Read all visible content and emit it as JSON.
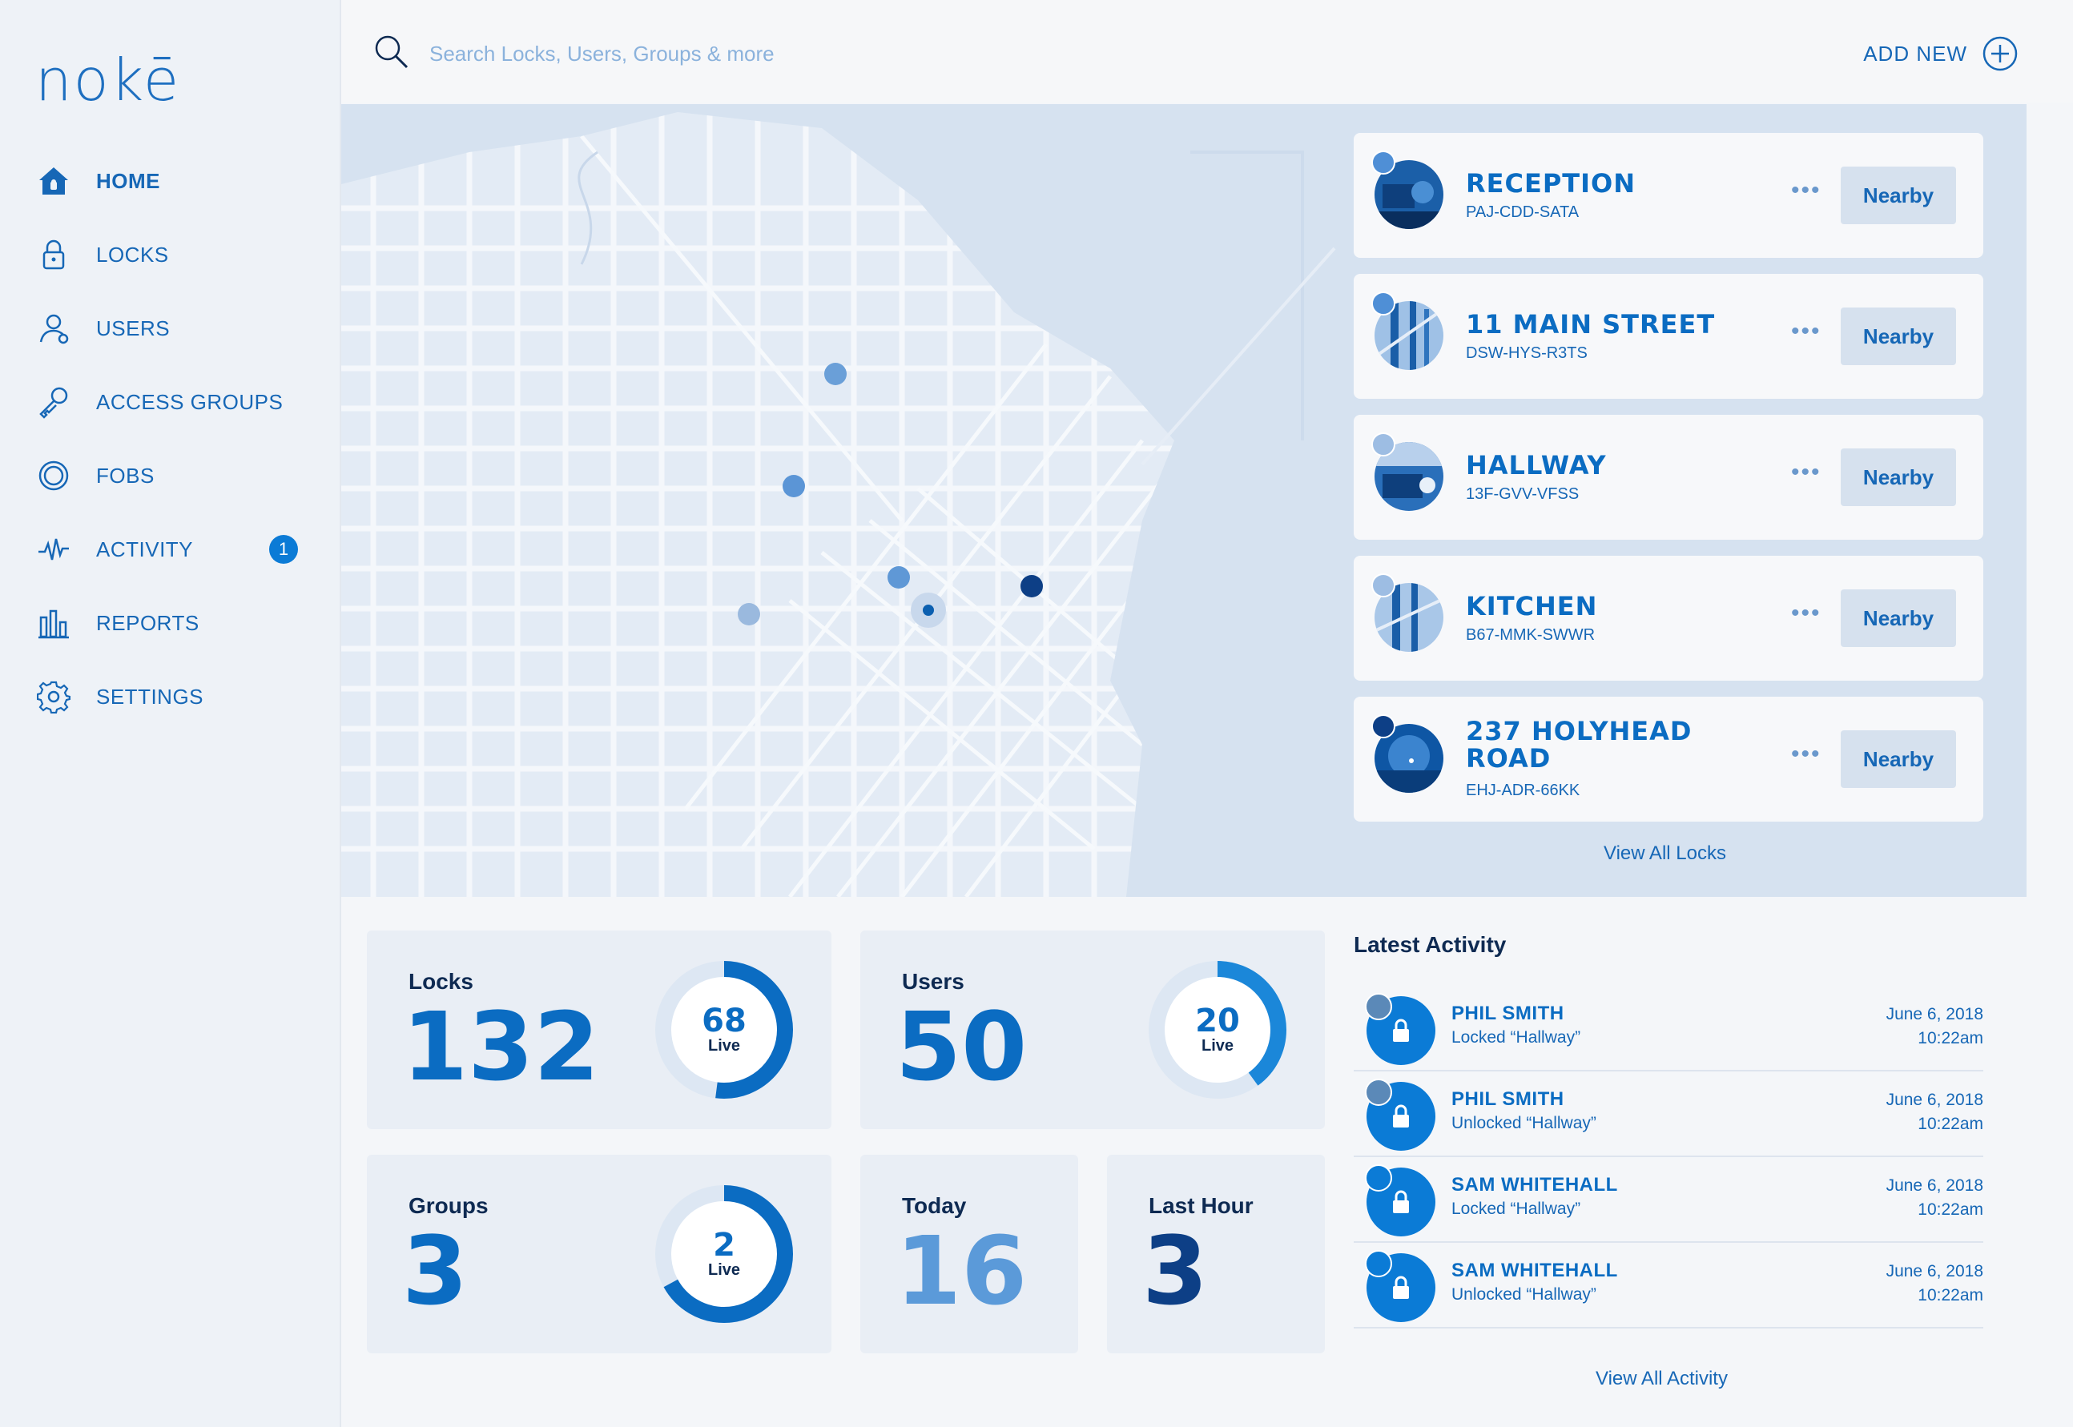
{
  "app": {
    "logo": "nokē"
  },
  "nav": [
    {
      "label": "HOME",
      "icon": "home-icon",
      "active": true
    },
    {
      "label": "LOCKS",
      "icon": "lock-icon"
    },
    {
      "label": "USERS",
      "icon": "user-icon"
    },
    {
      "label": "ACCESS GROUPS",
      "icon": "key-icon"
    },
    {
      "label": "FOBS",
      "icon": "fob-icon"
    },
    {
      "label": "ACTIVITY",
      "icon": "pulse-icon",
      "badge": "1"
    },
    {
      "label": "REPORTS",
      "icon": "bar-chart-icon"
    },
    {
      "label": "SETTINGS",
      "icon": "gear-icon"
    }
  ],
  "search": {
    "placeholder": "Search Locks, Users, Groups & more"
  },
  "header": {
    "add_new": "ADD NEW"
  },
  "locks": [
    {
      "name": "RECEPTION",
      "code": "PAJ-CDD-SATA",
      "action": "Nearby",
      "more": "•••",
      "dot_color": "#4f8fd6"
    },
    {
      "name": "11 MAIN STREET",
      "code": "DSW-HYS-R3TS",
      "action": "Nearby",
      "more": "•••",
      "dot_color": "#4f8fd6"
    },
    {
      "name": "HALLWAY",
      "code": "13F-GVV-VFSS",
      "action": "Nearby",
      "more": "•••",
      "dot_color": "#9dbde3"
    },
    {
      "name": "KITCHEN",
      "code": "B67-MMK-SWWR",
      "action": "Nearby",
      "more": "•••",
      "dot_color": "#9dbde3"
    },
    {
      "name": "237 HOLYHEAD ROAD",
      "code": "EHJ-ADR-66KK",
      "action": "Nearby",
      "more": "•••",
      "dot_color": "#0d3f86"
    }
  ],
  "locks_view_all": "View All Locks",
  "stats": {
    "locks": {
      "label": "Locks",
      "value": "132",
      "live": "68",
      "live_label": "Live",
      "live_fraction": 0.52
    },
    "users": {
      "label": "Users",
      "value": "50",
      "live": "20",
      "live_label": "Live",
      "live_fraction": 0.4
    },
    "groups": {
      "label": "Groups",
      "value": "3",
      "live": "2",
      "live_label": "Live",
      "live_fraction": 0.67
    },
    "today": {
      "label": "Today",
      "value": "16"
    },
    "last_hour": {
      "label": "Last Hour",
      "value": "3"
    }
  },
  "activity": {
    "title": "Latest Activity",
    "items": [
      {
        "name": "PHIL SMITH",
        "desc": "Locked “Hallway”",
        "date": "June 6, 2018",
        "time": "10:22am"
      },
      {
        "name": "PHIL SMITH",
        "desc": "Unlocked “Hallway”",
        "date": "June 6, 2018",
        "time": "10:22am"
      },
      {
        "name": "SAM WHITEHALL",
        "desc": "Locked “Hallway”",
        "date": "June 6, 2018",
        "time": "10:22am"
      },
      {
        "name": "SAM WHITEHALL",
        "desc": "Unlocked “Hallway”",
        "date": "June 6, 2018",
        "time": "10:22am"
      }
    ],
    "view_all": "View All Activity"
  },
  "colors": {
    "accent": "#0b6cc2",
    "map_bg": "#dbe5f1",
    "sidebar": "#eef2f7"
  }
}
